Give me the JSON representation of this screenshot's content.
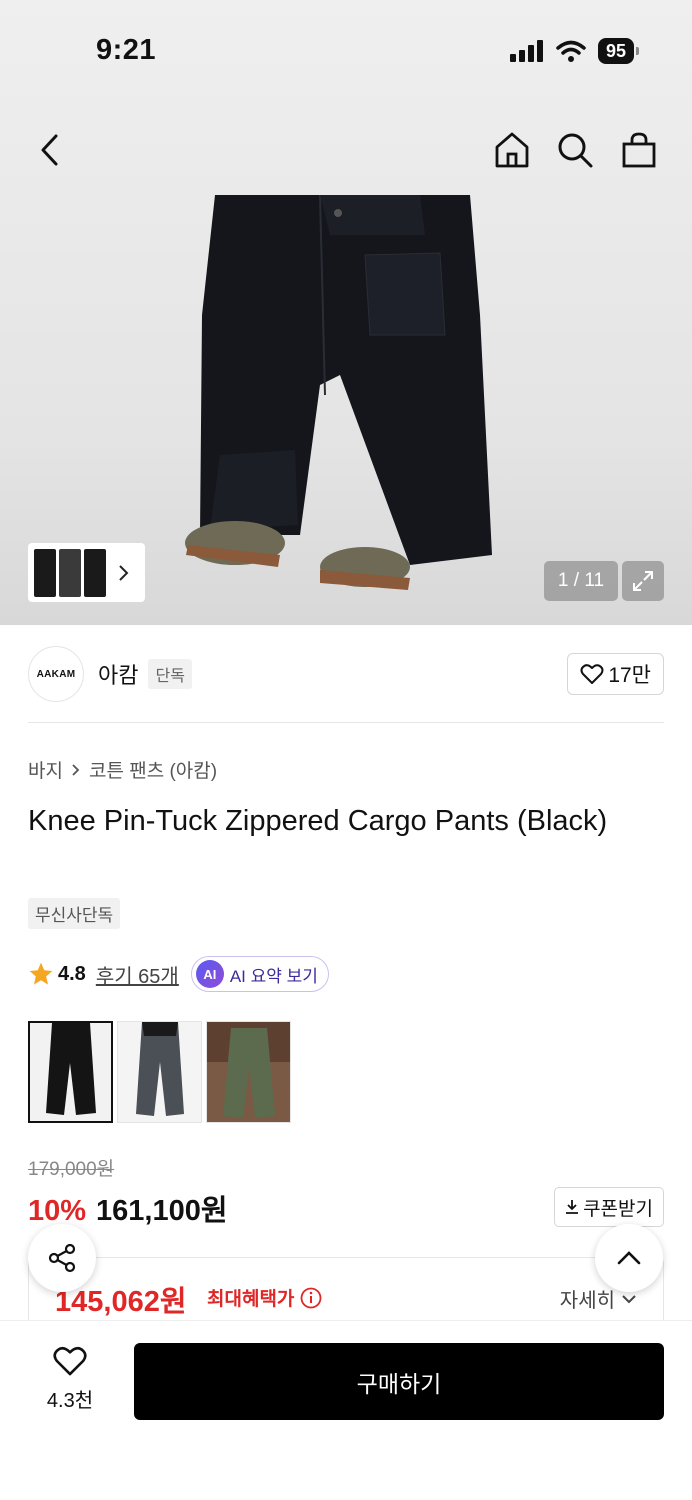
{
  "status_bar": {
    "time": "9:21",
    "battery": "95"
  },
  "top_nav": {
    "back": "back-icon",
    "home": "home-icon",
    "search": "search-icon",
    "cart": "shopping-bag-icon"
  },
  "gallery": {
    "counter": "1 / 11"
  },
  "brand": {
    "logo_text": "AAKAM",
    "name": "아캄",
    "tag": "단독",
    "likes": "17만"
  },
  "breadcrumb": [
    "바지",
    "코튼 팬츠 (아캄)"
  ],
  "product": {
    "title": "Knee Pin-Tuck Zippered Cargo Pants (Black)",
    "exclusive_tag": "무신사단독",
    "rating": "4.8",
    "reviews": "후기 65개",
    "ai_badge": "AI",
    "ai_summary": "AI 요약 보기"
  },
  "colors": {
    "star": "#f5a623",
    "accent_red": "#e02727",
    "ai_purple": "#3e2a9c"
  },
  "pricing": {
    "original": "179,000원",
    "discount": "10%",
    "price": "161,100원",
    "coupon": "쿠폰받기",
    "max_benefit_price": "145,062원",
    "max_benefit_label": "최대혜택가",
    "detail": "자세히"
  },
  "bottom_bar": {
    "likes": "4.3천",
    "buy": "구매하기"
  }
}
